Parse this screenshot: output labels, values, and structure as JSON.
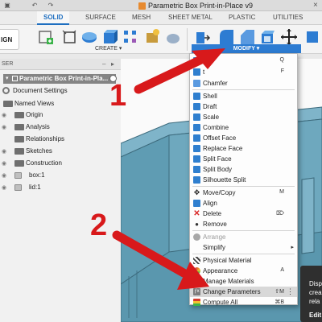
{
  "window": {
    "title": "Parametric Box Print-in-Place v9",
    "close_glyph": "×"
  },
  "workspace_tabs": [
    "SOLID",
    "SURFACE",
    "MESH",
    "SHEET METAL",
    "PLASTIC",
    "UTILITIES"
  ],
  "ribbon": {
    "design_label": "IGN",
    "create_label": "CREATE",
    "create_caret": "▾",
    "modify_label": "MODIFY",
    "modify_caret": "▾",
    "tools": [
      "sketch-icon",
      "box-icon",
      "revolve-icon",
      "extrude-icon",
      "pattern-icon",
      "fastener-icon",
      "push-pull-icon",
      "fillet-icon",
      "chamfer-icon",
      "shell-icon",
      "move-icon"
    ]
  },
  "browser": {
    "header_label": "BROWSER",
    "header_visible": "SER",
    "root": "Parametric Box Print-in-Pla...",
    "items": [
      {
        "label": "Document Settings",
        "icon": "gear-icon"
      },
      {
        "label": "Named Views",
        "icon": "folder-icon"
      },
      {
        "label": "Origin",
        "icon": "folder-icon"
      },
      {
        "label": "Analysis",
        "icon": "folder-icon"
      },
      {
        "label": "Relationships",
        "icon": "folder-icon"
      },
      {
        "label": "Sketches",
        "icon": "folder-icon"
      },
      {
        "label": "Construction",
        "icon": "folder-icon"
      },
      {
        "label": "box:1",
        "icon": "component-icon"
      },
      {
        "label": "lid:1",
        "icon": "component-icon"
      }
    ]
  },
  "modify_menu": {
    "items": [
      {
        "label": "Pull",
        "shortcut": "Q",
        "icon": "push-pull-icon",
        "color": "#2f7fcf"
      },
      {
        "label": "t",
        "shortcut": "F",
        "icon": "fillet-icon",
        "color": "#2f7fcf"
      },
      {
        "label": "Chamfer",
        "shortcut": "",
        "icon": "chamfer-icon",
        "color": "#2f7fcf"
      },
      {
        "label": "Shell",
        "shortcut": "",
        "icon": "shell-icon",
        "color": "#2f7fcf"
      },
      {
        "label": "Draft",
        "shortcut": "",
        "icon": "draft-icon",
        "color": "#2f7fcf"
      },
      {
        "label": "Scale",
        "shortcut": "",
        "icon": "scale-icon",
        "color": "#2f7fcf"
      },
      {
        "label": "Combine",
        "shortcut": "",
        "icon": "combine-icon",
        "color": "#2f7fcf"
      },
      {
        "label": "Offset Face",
        "shortcut": "",
        "icon": "offset-face-icon",
        "color": "#2f7fcf"
      },
      {
        "label": "Replace Face",
        "shortcut": "",
        "icon": "replace-face-icon",
        "color": "#2f7fcf"
      },
      {
        "label": "Split Face",
        "shortcut": "",
        "icon": "split-face-icon",
        "color": "#2f7fcf"
      },
      {
        "label": "Split Body",
        "shortcut": "",
        "icon": "split-body-icon",
        "color": "#2f7fcf"
      },
      {
        "label": "Silhouette Split",
        "shortcut": "",
        "icon": "silhouette-split-icon",
        "color": "#2f7fcf"
      },
      {
        "label": "Move/Copy",
        "shortcut": "M",
        "icon": "move-icon",
        "color": "#333333"
      },
      {
        "label": "Align",
        "shortcut": "",
        "icon": "align-icon",
        "color": "#2f7fcf"
      },
      {
        "label": "Delete",
        "shortcut": "⌦",
        "icon": "delete-icon",
        "color": "#d92626"
      },
      {
        "label": "Remove",
        "shortcut": "",
        "icon": "remove-icon",
        "color": "#333333"
      },
      {
        "label": "Arrange",
        "shortcut": "",
        "icon": "arrange-icon",
        "color": "#9a9a9a"
      },
      {
        "label": "Simplify",
        "shortcut": "",
        "icon": "simplify-icon",
        "color": "#ffffff"
      },
      {
        "label": "Physical Material",
        "shortcut": "",
        "icon": "physical-material-icon",
        "color": "#444444"
      },
      {
        "label": "Appearance",
        "shortcut": "A",
        "icon": "appearance-icon",
        "color": "#e05a2b"
      },
      {
        "label": "Manage Materials",
        "shortcut": "",
        "icon": "manage-materials-icon",
        "color": "#666666"
      },
      {
        "label": "Change Parameters",
        "shortcut": "⇧M",
        "icon": "change-parameters-icon",
        "color": "#7c7c7c"
      },
      {
        "label": "Compute All",
        "shortcut": "⌘B",
        "icon": "compute-all-icon",
        "color": "#d0a020"
      }
    ],
    "submenu_arrow": "▸",
    "more_glyph": "⋮"
  },
  "tooltip": {
    "lines": [
      "Disp",
      "crea",
      "rela",
      "Edit"
    ]
  },
  "annotations": {
    "step1": "1",
    "step2": "2",
    "arrow_color": "#d8191b"
  },
  "colors": {
    "accent": "#2d7cd2",
    "model": "#5f9cb3"
  }
}
